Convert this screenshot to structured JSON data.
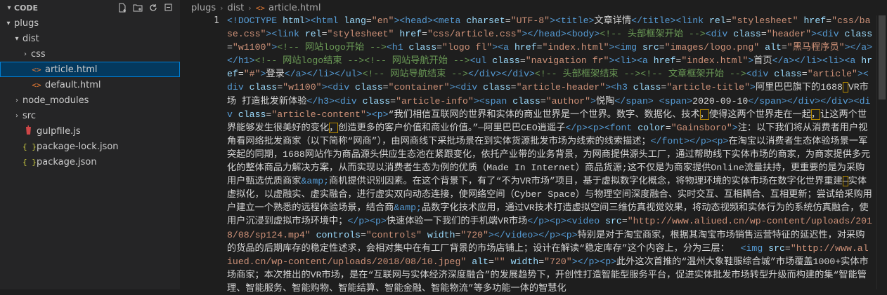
{
  "explorer": {
    "title": "CODE",
    "actions": [
      "new-file-icon",
      "new-folder-icon",
      "refresh-icon",
      "collapse-all-icon"
    ],
    "tree": [
      {
        "label": "plugs",
        "type": "folder-open",
        "depth": 0
      },
      {
        "label": "dist",
        "type": "folder-open",
        "depth": 1
      },
      {
        "label": "css",
        "type": "folder-closed",
        "depth": 2
      },
      {
        "label": "article.html",
        "type": "html",
        "depth": 2,
        "selected": true
      },
      {
        "label": "default.html",
        "type": "html",
        "depth": 2
      },
      {
        "label": "node_modules",
        "type": "folder-closed",
        "depth": 1
      },
      {
        "label": "src",
        "type": "folder-closed",
        "depth": 1
      },
      {
        "label": "gulpfile.js",
        "type": "gulp",
        "depth": 1
      },
      {
        "label": "package-lock.json",
        "type": "json",
        "depth": 1
      },
      {
        "label": "package.json",
        "type": "json",
        "depth": 1
      }
    ]
  },
  "editor": {
    "breadcrumbs": [
      "plugs",
      "dist",
      "article.html"
    ],
    "line_number": "1",
    "colors": {
      "tag": "#569cd6",
      "attr": "#9cdcfe",
      "string": "#ce9178",
      "comment": "#6a9955",
      "text": "#d4d4d4",
      "entity": "#569cd6",
      "highlight_border": "#b58900"
    },
    "tokens": [
      [
        "tag",
        "<!DOCTYPE"
      ],
      [
        "attr",
        " html"
      ],
      [
        "tag",
        ">"
      ],
      [
        "tag",
        "<html "
      ],
      [
        "attr",
        "lang"
      ],
      [
        "text",
        "="
      ],
      [
        "string",
        "\"en\""
      ],
      [
        "tag",
        ">"
      ],
      [
        "tag",
        "<head>"
      ],
      [
        "tag",
        "<meta "
      ],
      [
        "attr",
        "charset"
      ],
      [
        "text",
        "="
      ],
      [
        "string",
        "\"UTF-8\""
      ],
      [
        "tag",
        ">"
      ],
      [
        "tag",
        "<title>"
      ],
      [
        "text",
        "文章详情"
      ],
      [
        "tag",
        "</title>"
      ],
      [
        "tag",
        "<link "
      ],
      [
        "attr",
        "rel"
      ],
      [
        "text",
        "="
      ],
      [
        "string",
        "\"stylesheet\" "
      ],
      [
        "attr",
        "href"
      ],
      [
        "text",
        "="
      ],
      [
        "string",
        "\"css/base.css\""
      ],
      [
        "tag",
        ">"
      ],
      [
        "tag",
        "<link "
      ],
      [
        "attr",
        "rel"
      ],
      [
        "text",
        "="
      ],
      [
        "string",
        "\"stylesheet\" "
      ],
      [
        "attr",
        "href"
      ],
      [
        "text",
        "="
      ],
      [
        "string",
        "\"css/article.css\""
      ],
      [
        "tag",
        ">"
      ],
      [
        "tag",
        "</head>"
      ],
      [
        "tag",
        "<body>"
      ],
      [
        "comment",
        "<!-- 头部框架开始 -->"
      ],
      [
        "tag",
        "<div "
      ],
      [
        "attr",
        "class"
      ],
      [
        "text",
        "="
      ],
      [
        "string",
        "\"header\""
      ],
      [
        "tag",
        "><div "
      ],
      [
        "attr",
        "class"
      ],
      [
        "text",
        "="
      ],
      [
        "string",
        "\"w1100\""
      ],
      [
        "tag",
        ">"
      ],
      [
        "comment",
        "<!-- 网站logo开始 -->"
      ],
      [
        "tag",
        "<h1 "
      ],
      [
        "attr",
        "class"
      ],
      [
        "text",
        "="
      ],
      [
        "string",
        "\"logo fl\""
      ],
      [
        "tag",
        ">"
      ],
      [
        "tag",
        "<a "
      ],
      [
        "attr",
        "href"
      ],
      [
        "text",
        "="
      ],
      [
        "string",
        "\"index.html\""
      ],
      [
        "tag",
        ">"
      ],
      [
        "tag",
        "<img "
      ],
      [
        "attr",
        "src"
      ],
      [
        "text",
        "="
      ],
      [
        "string",
        "\"images/logo.png\" "
      ],
      [
        "attr",
        "alt"
      ],
      [
        "text",
        "="
      ],
      [
        "string",
        "\"黑马程序员\""
      ],
      [
        "tag",
        "></a></h1>"
      ],
      [
        "comment",
        "<!-- 网站logo结束 -->"
      ],
      [
        "comment",
        "<!-- 网站导航开始 -->"
      ],
      [
        "tag",
        "<ul "
      ],
      [
        "attr",
        "class"
      ],
      [
        "text",
        "="
      ],
      [
        "string",
        "\"navigation fr\""
      ],
      [
        "tag",
        "><li><a "
      ],
      [
        "attr",
        "href"
      ],
      [
        "text",
        "="
      ],
      [
        "string",
        "\"index.html\""
      ],
      [
        "tag",
        ">"
      ],
      [
        "text",
        "首页"
      ],
      [
        "tag",
        "</a></li><li><a "
      ],
      [
        "attr",
        "href"
      ],
      [
        "text",
        "="
      ],
      [
        "string",
        "\"#\""
      ],
      [
        "tag",
        ">"
      ],
      [
        "text",
        "登录"
      ],
      [
        "tag",
        "</a></li></ul>"
      ],
      [
        "comment",
        "<!-- 网站导航结束 -->"
      ],
      [
        "tag",
        "</div></div>"
      ],
      [
        "comment",
        "<!-- 头部框架结束 -->"
      ],
      [
        "comment",
        "<!-- 文章框架开始 -->"
      ],
      [
        "tag",
        "<div "
      ],
      [
        "attr",
        "class"
      ],
      [
        "text",
        "="
      ],
      [
        "string",
        "\"article\""
      ],
      [
        "tag",
        "><div "
      ],
      [
        "attr",
        "class"
      ],
      [
        "text",
        "="
      ],
      [
        "string",
        "\"w1100\""
      ],
      [
        "tag",
        "><div "
      ],
      [
        "attr",
        "class"
      ],
      [
        "text",
        "="
      ],
      [
        "string",
        "\"container\""
      ],
      [
        "tag",
        "><div "
      ],
      [
        "attr",
        "class"
      ],
      [
        "text",
        "="
      ],
      [
        "string",
        "\"article-header\""
      ],
      [
        "tag",
        "><h3 "
      ],
      [
        "attr",
        "class"
      ],
      [
        "text",
        "="
      ],
      [
        "string",
        "\"article-title\""
      ],
      [
        "tag",
        ">"
      ],
      [
        "text",
        "阿里巴巴旗下的1688"
      ],
      [
        "hl",
        " "
      ],
      [
        "text",
        "VR市场 打造批发新体验"
      ],
      [
        "tag",
        "</h3><div "
      ],
      [
        "attr",
        "class"
      ],
      [
        "text",
        "="
      ],
      [
        "string",
        "\"article-info\""
      ],
      [
        "tag",
        "><span "
      ],
      [
        "attr",
        "class"
      ],
      [
        "text",
        "="
      ],
      [
        "string",
        "\"author\""
      ],
      [
        "tag",
        ">"
      ],
      [
        "text",
        "悦陶"
      ],
      [
        "tag",
        "</span> <span>"
      ],
      [
        "text",
        "2020-09-10"
      ],
      [
        "tag",
        "</span></div></div><div "
      ],
      [
        "attr",
        "class"
      ],
      [
        "text",
        "="
      ],
      [
        "string",
        "\"article-content\""
      ],
      [
        "tag",
        "><p>"
      ],
      [
        "text",
        "“我们相信互联网的世界和实体的商业世界是一个世界。数字、数据化、技术"
      ],
      [
        "hl",
        "，"
      ],
      [
        "text",
        "使得这两个世界走在一起"
      ],
      [
        "hl",
        "，"
      ],
      [
        "text",
        "让这两个世界能够发生很美好的变化"
      ],
      [
        "hl",
        "，"
      ],
      [
        "text",
        "创造更多的客户价值和商业价值。”—阿里巴巴CEO逍遥子"
      ],
      [
        "tag",
        "</p><p><font "
      ],
      [
        "attr",
        "color"
      ],
      [
        "text",
        "="
      ],
      [
        "string",
        "\"Gainsboro\""
      ],
      [
        "tag",
        ">"
      ],
      [
        "text",
        "注：以下我们将从消费者用户视角看网络批发商家（以下简称“网商”），由网商线下采批场景在到实体货源批发市场为线索的线索描述；"
      ],
      [
        "tag",
        "</font></p><p>"
      ],
      [
        "text",
        "在淘宝以消费者生态体验场景一军突起的同期，1688网站作为商品源头供应生态池在紧跟变化，依托产业带的业务背景，为网商提供源头工厂，通过帮助线下实体市场的商家，为商家提供多元化的整体商品力解决方案，从而实现以消费者生态为例的优质（Made In Internet）商品货源;这不仅是为商家提供Online流量扶持，更重要的是为采购用户甄选优质商家"
      ],
      [
        "entity",
        "&amp;"
      ],
      [
        "text",
        "商机提供识别因素。在这个背景下，有了“不为VR市场”项目，基于虚拟数字化概念，将物理环境的实体市场在数字化世界重建"
      ],
      [
        "hl",
        "—"
      ],
      [
        "text",
        "实体虚拟化，以虚融实、虚实融合，进行虚实双向动态连接，使网络空间（Cyber Space）与物理空间深度融合、实时交互、互相耦合、互相更新；尝试给采购用户建立一个熟悉的远程体验场景，结合商"
      ],
      [
        "entity",
        "&amp;"
      ],
      [
        "text",
        "品数字化技术应用，通过VR技术打造虚拟空间三维仿真视觉效果，将动态视频和实体行为的系统仿真融合，使用户沉浸到虚拟市场环境中；"
      ],
      [
        "tag",
        "</p><p>"
      ],
      [
        "text",
        "快速体验一下我们的手机端VR市场"
      ],
      [
        "tag",
        "</p><p><video "
      ],
      [
        "attr",
        "src"
      ],
      [
        "text",
        "="
      ],
      [
        "string",
        "\"http://www.aliued.cn/wp-content/uploads/2018/08/sp124.mp4\" "
      ],
      [
        "attr",
        "controls"
      ],
      [
        "text",
        "="
      ],
      [
        "string",
        "\"controls\" "
      ],
      [
        "attr",
        "width"
      ],
      [
        "text",
        "="
      ],
      [
        "string",
        "\"720\""
      ],
      [
        "tag",
        "></video></p><p>"
      ],
      [
        "text",
        "特别是对于淘宝商家，根据其淘宝市场销售运营特征的延迟性，对采购的货品的后期库存的稳定性述求，会相对集中在有工厂背景的市场店铺上；设计在解读“稳定库存”这个内容上，分为三层：  "
      ],
      [
        "tag",
        "<img "
      ],
      [
        "attr",
        "src"
      ],
      [
        "text",
        "="
      ],
      [
        "string",
        "\"http://www.aliued.cn/wp-content/uploads/2018/08/10.jpeg\" "
      ],
      [
        "attr",
        "alt"
      ],
      [
        "text",
        "="
      ],
      [
        "string",
        "\"\" "
      ],
      [
        "attr",
        "width"
      ],
      [
        "text",
        "="
      ],
      [
        "string",
        "\"720\""
      ],
      [
        "tag",
        "></p><p>"
      ],
      [
        "text",
        "此外这次首推的“温州大象鞋服综合城”市场覆盖1000+实体市场商家；本次推出的VR市场，是在“互联网与实体经济深度融合”的发展趋势下，开创性打造智能型服务平台，促进实体批发市场转型升级而构建的集“智能管理、智能服务、智能购物、智能结算、智能金融、智能物流”等多功能一体的智慧化"
      ]
    ]
  }
}
